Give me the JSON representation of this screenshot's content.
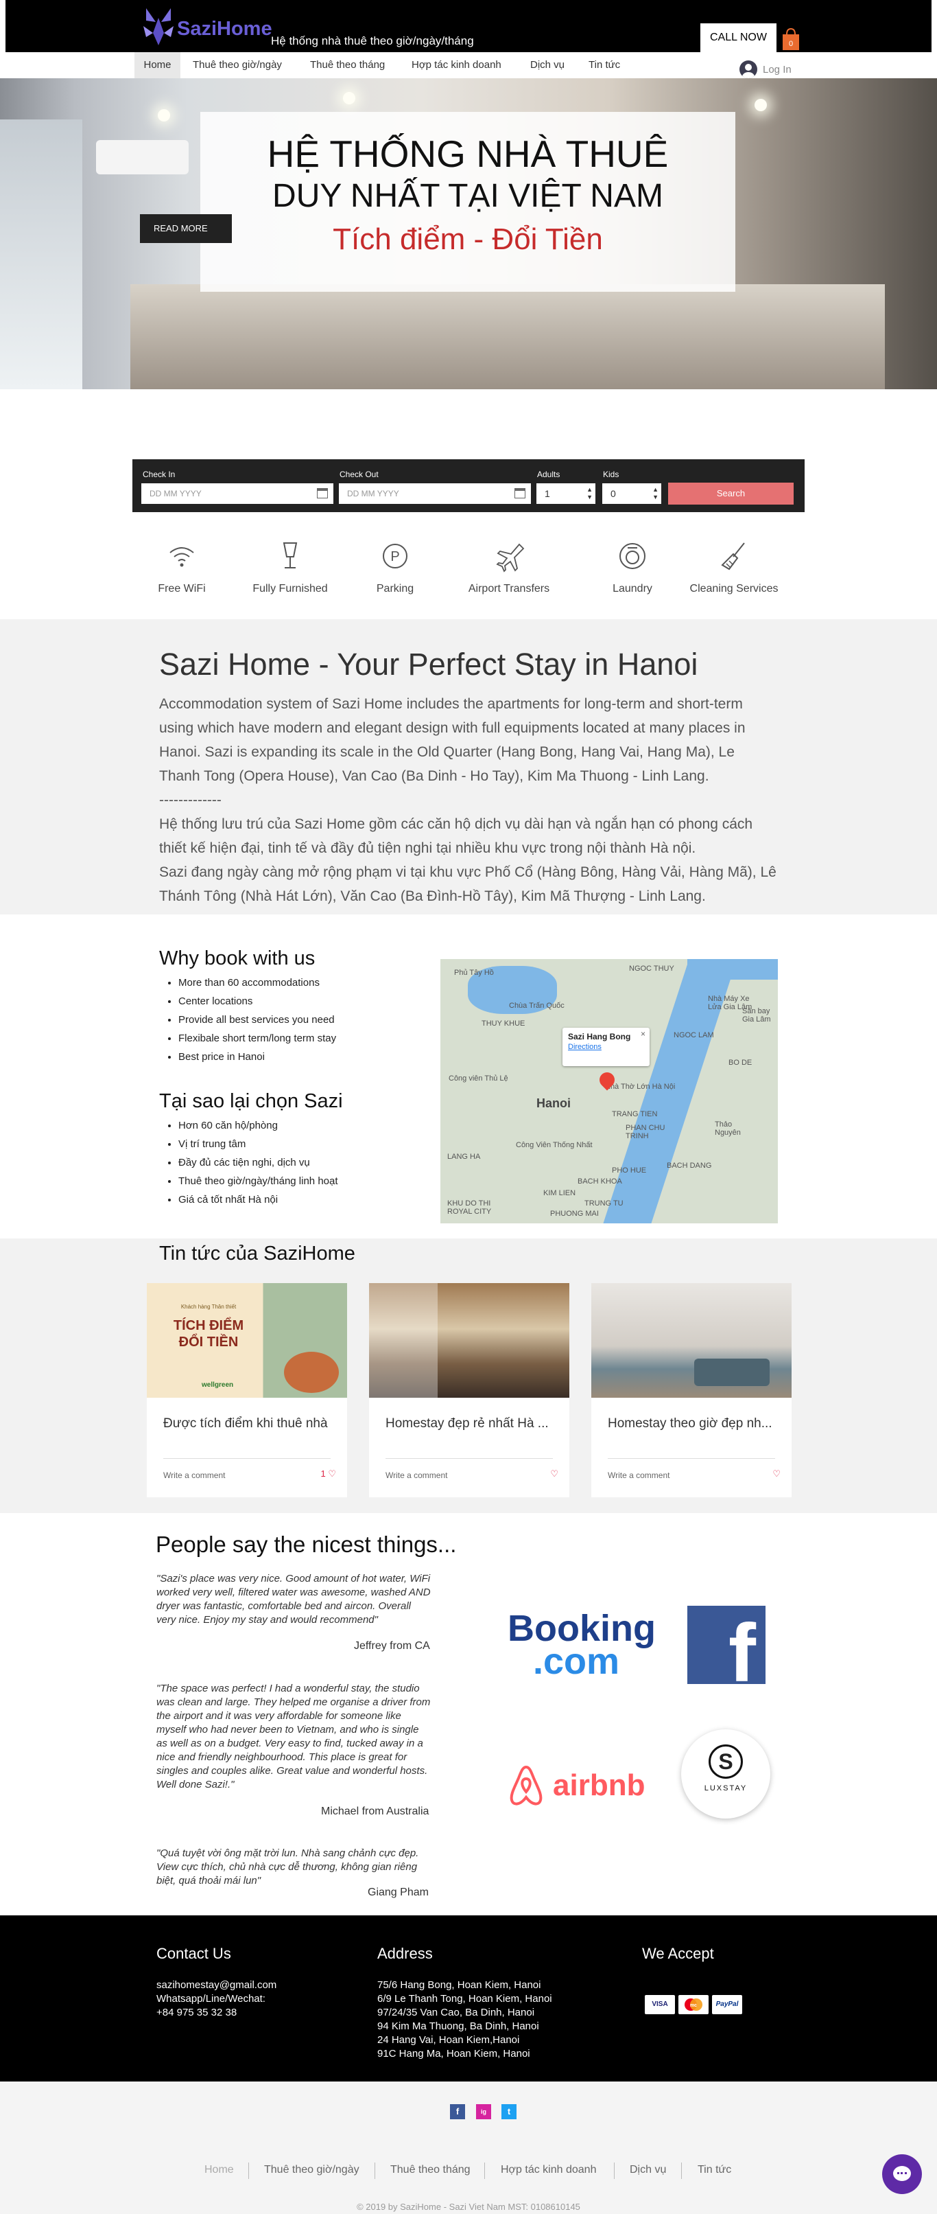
{
  "header": {
    "brand": "SaziHome",
    "tagline": "Hệ thống nhà thuê theo giờ/ngày/tháng",
    "call_button": "CALL NOW",
    "cart_count": "0",
    "login": "Log In"
  },
  "nav": {
    "items": [
      {
        "label": "Home"
      },
      {
        "label": "Thuê theo giờ/ngày"
      },
      {
        "label": "Thuê theo tháng"
      },
      {
        "label": "Hợp tác kinh doanh"
      },
      {
        "label": "Dịch vụ"
      },
      {
        "label": "Tin tức"
      }
    ]
  },
  "hero": {
    "line1": "HỆ THỐNG NHÀ THUÊ",
    "line2": "DUY NHẤT TẠI VIỆT NAM",
    "line3": "Tích điểm - Đổi Tiền",
    "read_more": "READ MORE"
  },
  "booking": {
    "checkin_label": "Check In",
    "checkin_placeholder": "DD MM YYYY",
    "checkout_label": "Check Out",
    "checkout_placeholder": "DD MM YYYY",
    "adults_label": "Adults",
    "adults_value": "1",
    "kids_label": "Kids",
    "kids_value": "0",
    "search": "Search"
  },
  "amenities": [
    {
      "label": "Free WiFi",
      "icon": "wifi-icon"
    },
    {
      "label": "Fully Furnished",
      "icon": "lamp-icon"
    },
    {
      "label": "Parking",
      "icon": "parking-icon"
    },
    {
      "label": "Airport Transfers",
      "icon": "plane-icon"
    },
    {
      "label": "Laundry",
      "icon": "washer-icon"
    },
    {
      "label": "Cleaning Services",
      "icon": "broom-icon"
    }
  ],
  "about": {
    "title": "Sazi Home - Your Perfect Stay in Hanoi",
    "p1": "Accommodation system of Sazi Home includes the apartments for long-term and short-term using which have modern and elegant design with full equipments located at many places in Hanoi. Sazi is expanding its scale in the Old Quarter (Hang Bong, Hang Vai, Hang Ma), Le Thanh Tong (Opera House), Van Cao (Ba Dinh - Ho Tay), Kim Ma Thuong - Linh Lang.",
    "divider": "-------------",
    "p2": "Hệ thống lưu trú của Sazi Home gồm các căn hộ dịch vụ dài hạn và ngắn hạn có phong cách thiết kế hiện đại, tinh tế và đầy đủ tiện nghi tại nhiều khu vực trong nội thành Hà nội.",
    "p3": "Sazi đang ngày càng mở rộng phạm vi tại khu vực Phố Cổ (Hàng Bông, Hàng Vải, Hàng Mã), Lê Thánh Tông (Nhà Hát Lớn), Văn Cao (Ba Đình-Hồ Tây), Kim Mã Thượng - Linh Lang."
  },
  "why": {
    "title_en": "Why book with us",
    "items_en": [
      "More than 60 accommodations",
      "Center locations",
      "Provide all best services you need",
      "Flexibale short term/long term stay",
      "Best price in Hanoi"
    ],
    "title_vi": "Tại sao lại chọn Sazi",
    "items_vi": [
      "Hơn 60 căn hộ/phòng",
      "Vị trí trung tâm",
      "Đầy đủ các tiện nghi, dịch vụ",
      "Thuê theo giờ/ngày/tháng linh hoạt",
      "Giá cả tốt nhất Hà nội"
    ]
  },
  "map": {
    "place": "Sazi Hang Bong",
    "directions": "Directions",
    "labels": [
      "Phủ Tây Hồ",
      "NGOC THUY",
      "Chùa Trấn Quốc",
      "THUY KHUE",
      "Nhà Máy Xe Lửa Gia Lâm",
      "Sân bay Gia Lâm",
      "BO DE",
      "NGOC LAM",
      "Công viên Thủ Lệ",
      "Hanoi",
      "Nhà Thờ Lớn Hà Nội",
      "TRANG TIEN",
      "PHAN CHU TRINH",
      "Thảo Nguyên",
      "LANG HA",
      "PHO HUE",
      "BACH DANG",
      "Công Viên Thống Nhất",
      "KIM LIEN",
      "TRUNG TU",
      "KHU DO THI ROYAL CITY",
      "PHUONG MAI",
      "BACH KHOA"
    ]
  },
  "news": {
    "title": "Tin tức của SaziHome",
    "cards": [
      {
        "title": "Được tích điểm khi thuê nhà",
        "comment": "Write a comment",
        "likes": "1",
        "img_caption_small": "Khách hàng Thân thiết",
        "img_caption_big": "TÍCH ĐIỂM ĐỔI TIỀN",
        "img_brand": "wellgreen"
      },
      {
        "title": "Homestay đẹp rẻ nhất Hà ...",
        "comment": "Write a comment",
        "likes": ""
      },
      {
        "title": "Homestay theo giờ đẹp nh...",
        "comment": "Write a comment",
        "likes": ""
      }
    ]
  },
  "testimonials": {
    "title": "People say the nicest things...",
    "quotes": [
      {
        "text": "\"Sazi's place was very nice. Good amount of hot water, WiFi worked very well, filtered water was awesome, washed AND dryer was fantastic, comfortable bed and aircon. Overall very nice. Enjoy my stay and would recommend\"",
        "author": "Jeffrey from CA"
      },
      {
        "text": "\"The space was perfect! I had a wonderful stay, the studio was clean and large. They helped me organise a driver from the airport and it was very affordable for someone like myself who had never been to Vietnam, and who is single as well as on a budget. Very easy to find, tucked away in a nice and friendly neighbourhood. This place is great for singles and couples alike. Great value and wonderful hosts. Well done Sazi!.\"",
        "author": "Michael from Australia"
      },
      {
        "text": "\"Quá tuyệt vời ông mặt trời lun. Nhà sang chảnh cực đẹp. View cực thích, chủ nhà cực dễ thương, không gian riêng biệt, quá thoải mái lun\"",
        "author": "Giang Pham"
      }
    ],
    "partners": {
      "booking1": "Booking",
      "booking2": ".com",
      "facebook": "f",
      "airbnb": "airbnb",
      "luxstay": "LUXSTAY",
      "luxstay_mark": "S"
    }
  },
  "footer": {
    "contact_title": "Contact Us",
    "contact_lines": [
      "sazihomestay@gmail.com",
      "Whatsapp/Line/Wechat:",
      "+84 975 35 32 38"
    ],
    "address_title": "Address",
    "address_lines": [
      "75/6 Hang Bong, Hoan Kiem, Hanoi",
      "6/9 Le Thanh Tong, Hoan Kiem, Hanoi",
      "97/24/35 Van Cao, Ba Dinh, Hanoi",
      "94 Kim Ma Thuong, Ba Dinh, Hanoi",
      "24 Hang Vai, Hoan Kiem,Hanoi",
      "91C Hang Ma, Hoan Kiem, Hanoi"
    ],
    "accept_title": "We Accept",
    "cards": [
      "VISA",
      "mc",
      "PayPal"
    ],
    "social": [
      "f",
      "ig",
      "t"
    ],
    "nav": [
      "Home",
      "Thuê theo giờ/ngày",
      "Thuê theo tháng",
      "Hợp tác kinh doanh",
      "Dịch vụ",
      "Tin tức"
    ],
    "copyright": "© 2019 by SaziHome - Sazi Viet Nam MST: 0108610145"
  },
  "colors": {
    "accent": "#e57172",
    "brand": "#6a5fd6",
    "hero_red": "#c62b2b"
  }
}
